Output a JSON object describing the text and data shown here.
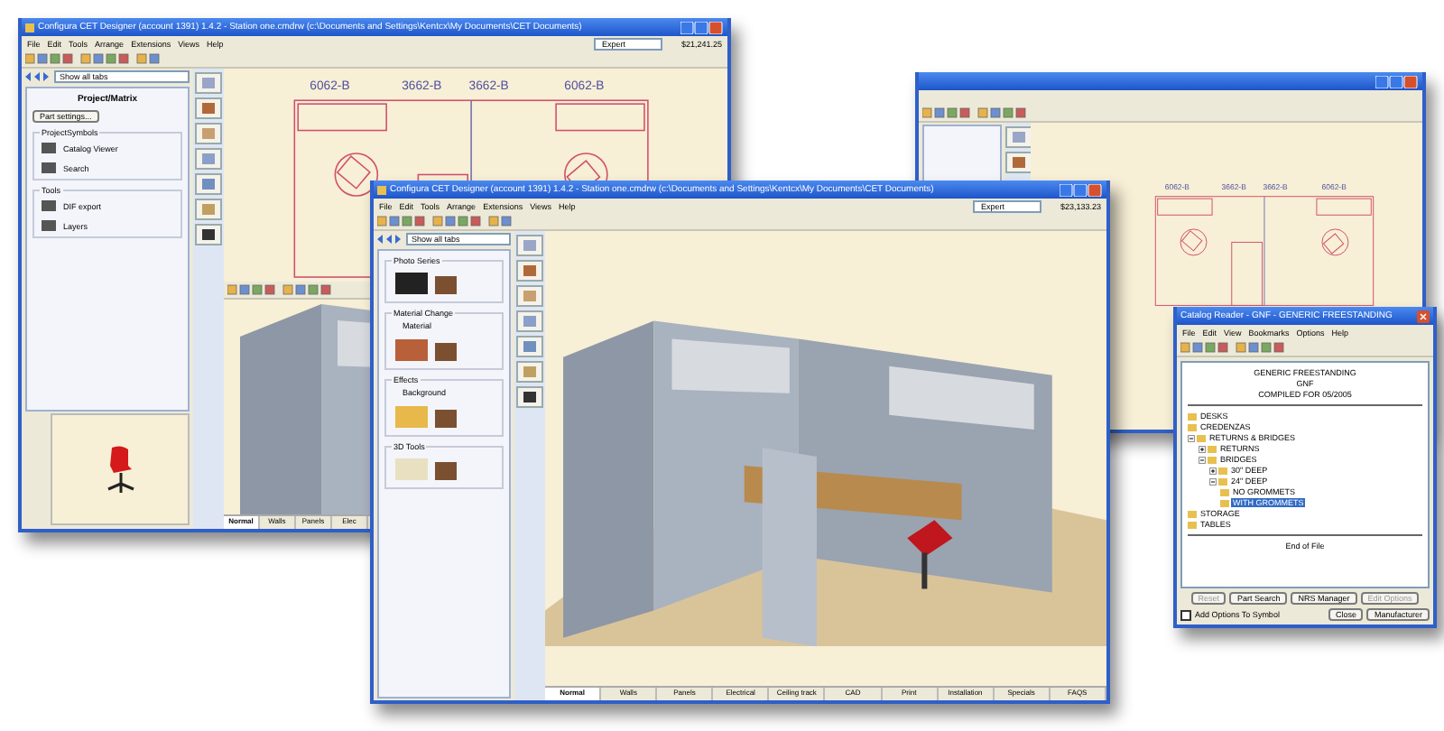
{
  "back_window": {
    "title": "Configura CET Designer (account 1391) 1.4.2 - Station one.cmdrw (c:\\Documents and Settings\\Kentcx\\My Documents\\CET Documents)",
    "menu": [
      "File",
      "Edit",
      "Tools",
      "Arrange",
      "Extensions",
      "Views",
      "Help"
    ],
    "mode": "Expert",
    "price": "$21,241.25",
    "filter": "Show all tabs",
    "panel_title": "Project/Matrix",
    "panel_button": "Part settings...",
    "groups": [
      {
        "title": "ProjectSymbols",
        "items": [
          {
            "label": "Catalog Viewer"
          },
          {
            "label": "Search"
          }
        ]
      },
      {
        "title": "Tools",
        "items": [
          {
            "label": "DIF export"
          },
          {
            "label": "Layers"
          }
        ]
      }
    ],
    "plan_labels": [
      "6062-B",
      "3662-B",
      "3662-B",
      "6062-B"
    ],
    "bottom_tabs": [
      {
        "label": "Normal",
        "selected": true
      },
      {
        "label": "Walls",
        "selected": false
      },
      {
        "label": "Panels",
        "selected": false
      },
      {
        "label": "Elec",
        "selected": false
      }
    ]
  },
  "right_window": {
    "plan_labels": [
      "6062-B",
      "3662-B",
      "3662-B",
      "6062-B"
    ]
  },
  "front_window": {
    "title": "Configura CET Designer (account 1391) 1.4.2 - Station one.cmdrw (c:\\Documents and Settings\\Kentcx\\My Documents\\CET Documents)",
    "menu": [
      "File",
      "Edit",
      "Tools",
      "Arrange",
      "Extensions",
      "Views",
      "Help"
    ],
    "mode": "Expert",
    "price": "$23,133.23",
    "filter": "Show all tabs",
    "groups": [
      {
        "title": "Photo Series"
      },
      {
        "title": "Material Change",
        "caption": "Material"
      },
      {
        "title": "Effects",
        "caption": "Background"
      },
      {
        "title": "3D Tools"
      }
    ],
    "bottom_tabs": [
      {
        "label": "Normal",
        "selected": true
      },
      {
        "label": "Walls",
        "selected": false
      },
      {
        "label": "Panels",
        "selected": false
      },
      {
        "label": "Electrical",
        "selected": false
      },
      {
        "label": "Ceiling track",
        "selected": false
      },
      {
        "label": "CAD",
        "selected": false
      },
      {
        "label": "Print",
        "selected": false
      },
      {
        "label": "Installation",
        "selected": false
      },
      {
        "label": "Specials",
        "selected": false
      },
      {
        "label": "FAQS",
        "selected": false
      }
    ]
  },
  "catalog_window": {
    "title": "Catalog Reader - GNF - GENERIC FREESTANDING",
    "menu": [
      "File",
      "Edit",
      "View",
      "Bookmarks",
      "Options",
      "Help"
    ],
    "header": [
      "GENERIC FREESTANDING",
      "GNF",
      "COMPILED FOR 05/2005"
    ],
    "tree": [
      {
        "label": "DESKS",
        "selected": false
      },
      {
        "label": "CREDENZAS",
        "selected": false
      },
      {
        "label": "RETURNS & BRIDGES",
        "selected": false,
        "expanded": true,
        "children": [
          {
            "label": "RETURNS",
            "selected": false,
            "expanded": false
          },
          {
            "label": "BRIDGES",
            "selected": false,
            "expanded": true,
            "children": [
              {
                "label": "30\" DEEP",
                "selected": false,
                "expanded": false
              },
              {
                "label": "24\" DEEP",
                "selected": false,
                "expanded": true,
                "children": [
                  {
                    "label": "NO GROMMETS",
                    "selected": false
                  },
                  {
                    "label": "WITH GROMMETS",
                    "selected": true
                  }
                ]
              }
            ]
          }
        ]
      },
      {
        "label": "STORAGE",
        "selected": false
      },
      {
        "label": "TABLES",
        "selected": false
      }
    ],
    "footer": "End of File",
    "buttons": [
      {
        "label": "Reset",
        "disabled": true
      },
      {
        "label": "Part Search",
        "disabled": false
      },
      {
        "label": "NRS Manager",
        "disabled": false
      },
      {
        "label": "Edit Options",
        "disabled": true
      }
    ],
    "option": {
      "label": "Add Options To Symbol",
      "checked": false
    },
    "actions": [
      "Close",
      "Manufacturer"
    ]
  }
}
